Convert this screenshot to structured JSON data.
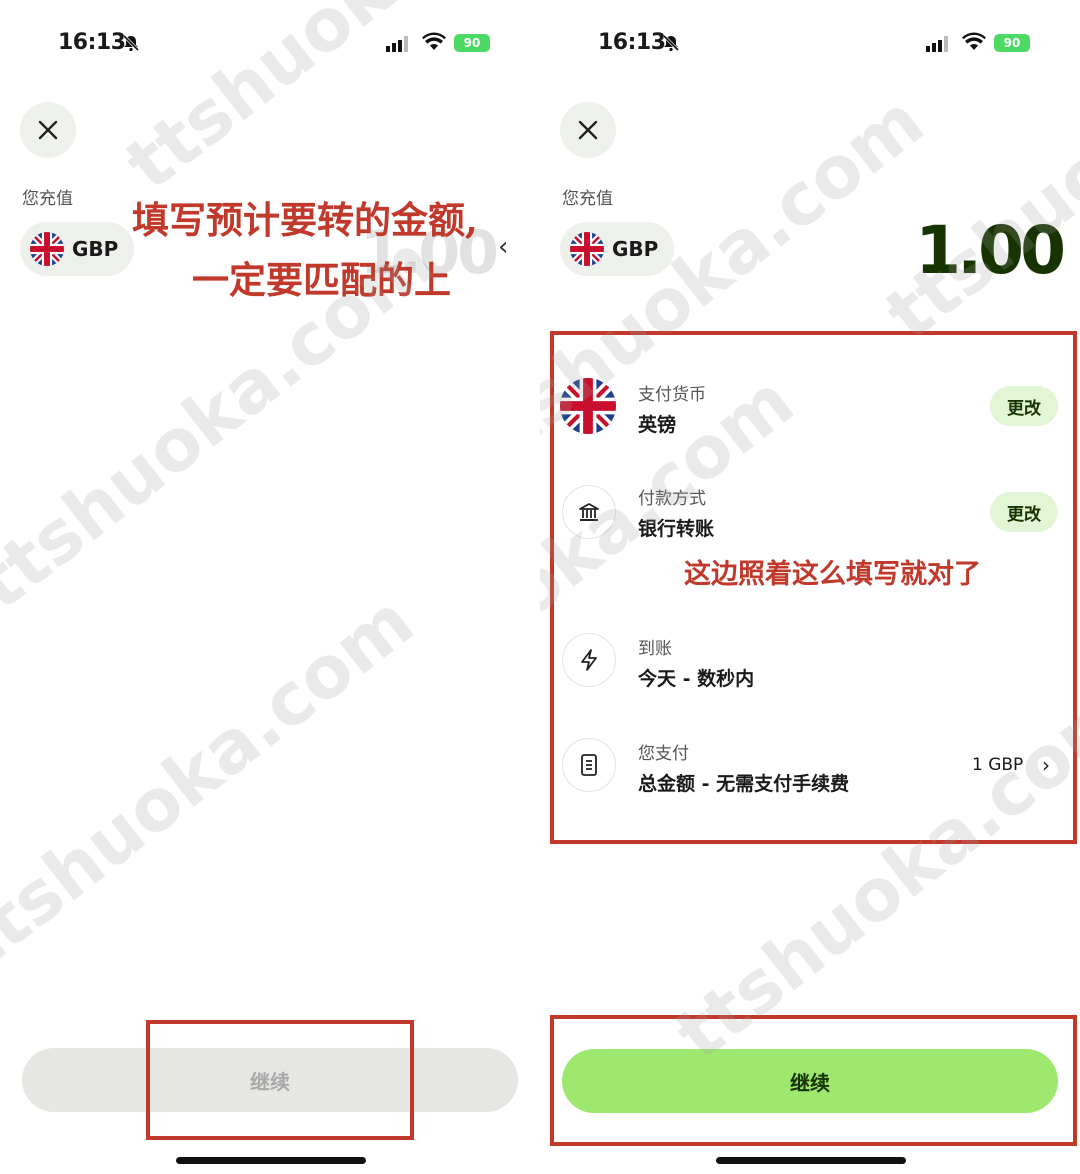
{
  "status_bar": {
    "time": "16:13",
    "battery": "90"
  },
  "left": {
    "topup_label": "您充值",
    "currency_code": "GBP",
    "amount_hint": "1.00",
    "annotation_line1": "填写预计要转的金额,",
    "annotation_line2": "一定要匹配的上",
    "continue_label": "继续"
  },
  "right": {
    "topup_label": "您充值",
    "currency_code": "GBP",
    "amount": "1.00",
    "rows": [
      {
        "label": "支付货币",
        "value": "英镑",
        "action": "更改",
        "icon": "uk-flag-icon"
      },
      {
        "label": "付款方式",
        "value": "银行转账",
        "action": "更改",
        "icon": "bank-icon"
      },
      {
        "label": "到账",
        "value": "今天 - 数秒内",
        "icon": "lightning-icon"
      },
      {
        "label": "您支付",
        "value": "总金额 - 无需支付手续费",
        "amount": "1 GBP",
        "icon": "receipt-icon"
      }
    ],
    "annotation": "这边照着这么填写就对了",
    "continue_label": "继续"
  },
  "watermark": "ttshuoka.com",
  "colors": {
    "accent_green": "#9fe870",
    "dark_green": "#163300",
    "annotation_red": "#c0392b",
    "pill_bg": "#eef0ec"
  }
}
